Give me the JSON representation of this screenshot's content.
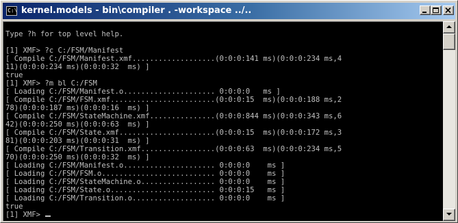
{
  "window": {
    "title": "kernel.models - bin\\compiler . -workspace ../.."
  },
  "console": {
    "lines": [
      "",
      "Type ?h for top level help.",
      "",
      "[1] XMF> ?c C:/FSM/Manifest",
      "[ Compile C:/FSM/Manifest.xmf...................(0:0:0:141 ms)(0:0:0:234 ms,4",
      "11)(0:0:0:234 ms)(0:0:0:32  ms) ]",
      "true",
      "[1] XMF> ?m bl C:/FSM",
      "[ Loading C:/FSM/Manifest.o..................... 0:0:0:0   ms ]",
      "[ Compile C:/FSM/FSM.xmf........................(0:0:0:15  ms)(0:0:0:188 ms,2",
      "78)(0:0:0:187 ms)(0:0:0:16  ms) ]",
      "[ Compile C:/FSM/StateMachine.xmf...............(0:0:0:844 ms)(0:0:0:343 ms,6",
      "42)(0:0:0:250 ms)(0:0:0:63  ms) ]",
      "[ Compile C:/FSM/State.xmf......................(0:0:0:15  ms)(0:0:0:172 ms,3",
      "81)(0:0:0:203 ms)(0:0:0:31  ms) ]",
      "[ Compile C:/FSM/Transition.xmf.................(0:0:0:63  ms)(0:0:0:234 ms,5",
      "70)(0:0:0:250 ms)(0:0:0:32  ms) ]",
      "[ Loading C:/FSM/Manifest.o..................... 0:0:0:0    ms ]",
      "[ Loading C:/FSM/FSM.o.......................... 0:0:0:0    ms ]",
      "[ Loading C:/FSM/StateMachine.o................. 0:0:0:0    ms ]",
      "[ Loading C:/FSM/State.o........................ 0:0:0:15   ms ]",
      "[ Loading C:/FSM/Transition.o................... 0:0:0:0    ms ]",
      "true",
      "[1] XMF> "
    ]
  },
  "icons": {
    "app": "console-icon",
    "minimize": "minimize-icon",
    "maximize": "maximize-icon",
    "close": "close-icon",
    "scroll_up": "arrow-up-icon",
    "scroll_down": "arrow-down-icon"
  },
  "colors": {
    "titlebar_start": "#0a246a",
    "titlebar_end": "#a6caf0",
    "console_bg": "#000000",
    "console_fg": "#c0c0c0"
  }
}
